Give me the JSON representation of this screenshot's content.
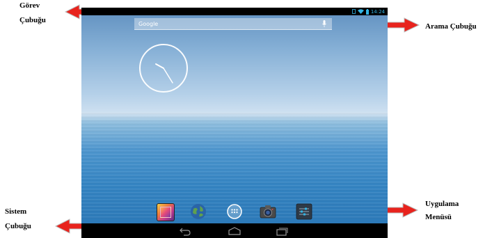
{
  "annotations": {
    "task_bar": {
      "line1": "Görev",
      "line2": "Çubuğu"
    },
    "search_bar": {
      "text": "Arama Çubuğu"
    },
    "system_bar": {
      "line1": "Sistem",
      "line2": "Çubuğu"
    },
    "app_menu": {
      "line1": "Uygulama",
      "line2": "Menüsü"
    }
  },
  "status_bar": {
    "time": "14:24",
    "icons": [
      "sim-icon",
      "wifi-icon",
      "battery-icon"
    ]
  },
  "search": {
    "placeholder": "Google",
    "mic_icon": "microphone-icon"
  },
  "dock": {
    "apps": [
      "gallery-icon",
      "browser-globe-icon",
      "all-apps-icon",
      "camera-icon",
      "settings-icon"
    ]
  },
  "nav": {
    "buttons": [
      "back-icon",
      "home-icon",
      "recent-apps-icon"
    ]
  },
  "colors": {
    "arrow": "#e8231d",
    "accent": "#33b5e5"
  }
}
